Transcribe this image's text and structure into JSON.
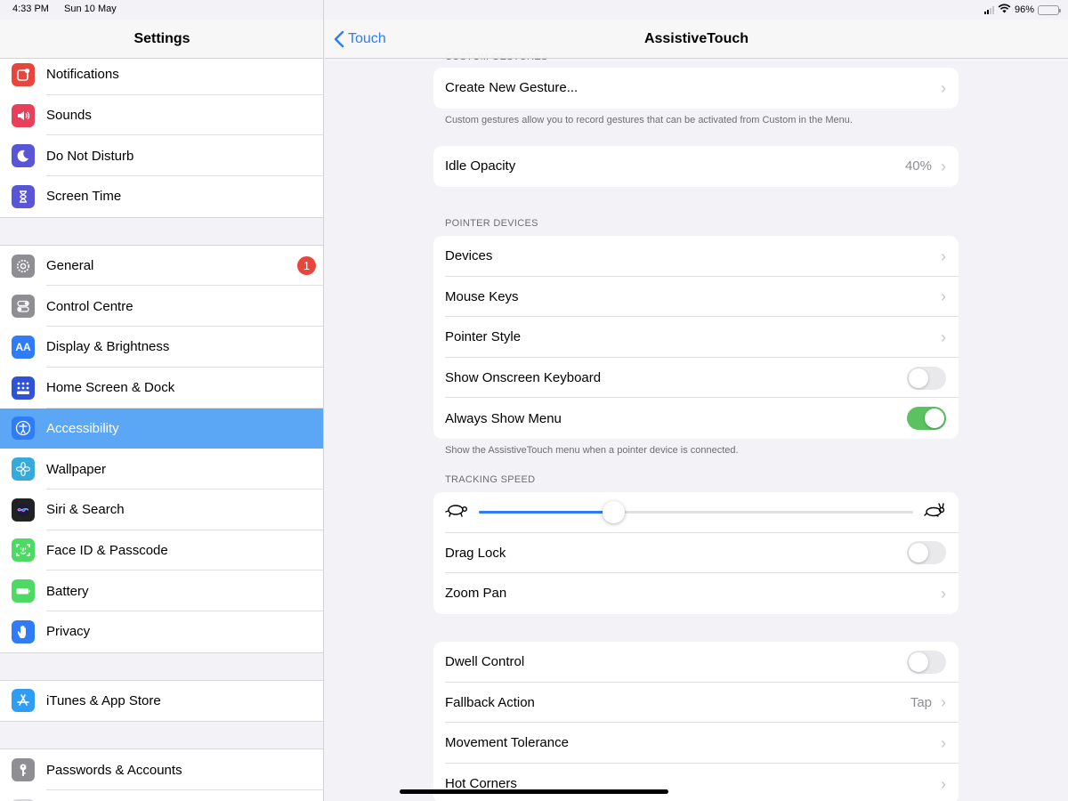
{
  "status_bar": {
    "time": "4:33 PM",
    "date": "Sun 10 May",
    "battery": "96%"
  },
  "sidebar": {
    "title": "Settings",
    "groups": [
      {
        "items": [
          {
            "label": "Notifications",
            "icon": "notifications-icon",
            "color": "#e8453c"
          },
          {
            "label": "Sounds",
            "icon": "sounds-icon",
            "color": "#e8405a"
          },
          {
            "label": "Do Not Disturb",
            "icon": "moon-icon",
            "color": "#5856d6"
          },
          {
            "label": "Screen Time",
            "icon": "hourglass-icon",
            "color": "#5856d6"
          }
        ]
      },
      {
        "items": [
          {
            "label": "General",
            "icon": "gear-icon",
            "color": "#8e8e93",
            "badge": "1"
          },
          {
            "label": "Control Centre",
            "icon": "toggles-icon",
            "color": "#8e8e93"
          },
          {
            "label": "Display & Brightness",
            "icon": "text-size-icon",
            "color": "#2f7cf6"
          },
          {
            "label": "Home Screen & Dock",
            "icon": "grid-icon",
            "color": "#2f52d6"
          },
          {
            "label": "Accessibility",
            "icon": "accessibility-icon",
            "color": "#2f7cf6",
            "selected": true
          },
          {
            "label": "Wallpaper",
            "icon": "flower-icon",
            "color": "#36aadc"
          },
          {
            "label": "Siri & Search",
            "icon": "siri-icon",
            "color": "#222222"
          },
          {
            "label": "Face ID & Passcode",
            "icon": "face-id-icon",
            "color": "#4cd964"
          },
          {
            "label": "Battery",
            "icon": "battery-icon",
            "color": "#4cd964"
          },
          {
            "label": "Privacy",
            "icon": "hand-icon",
            "color": "#2f7cf6"
          }
        ]
      },
      {
        "items": [
          {
            "label": "iTunes & App Store",
            "icon": "app-store-icon",
            "color": "#2f9cf6"
          }
        ]
      },
      {
        "items": [
          {
            "label": "Passwords & Accounts",
            "icon": "key-icon",
            "color": "#8e8e93"
          },
          {
            "label": "",
            "icon": "blank-icon",
            "color": "#d8d8dc"
          }
        ]
      }
    ]
  },
  "nav": {
    "back_label": "Touch",
    "title": "AssistiveTouch"
  },
  "main": {
    "clipped_header": "CUSTOM GESTURES",
    "create_gesture": "Create New Gesture...",
    "custom_footnote": "Custom gestures allow you to record gestures that can be activated from Custom in the Menu.",
    "idle_opacity_label": "Idle Opacity",
    "idle_opacity_value": "40%",
    "pointer_header": "POINTER DEVICES",
    "devices": "Devices",
    "mouse_keys": "Mouse Keys",
    "pointer_style": "Pointer Style",
    "show_keyboard": "Show Onscreen Keyboard",
    "show_keyboard_on": false,
    "always_show_menu": "Always Show Menu",
    "always_show_menu_on": true,
    "pointer_footnote": "Show the AssistiveTouch menu when a pointer device is connected.",
    "tracking_header": "TRACKING SPEED",
    "tracking_speed": 0.31,
    "drag_lock": "Drag Lock",
    "drag_lock_on": false,
    "zoom_pan": "Zoom Pan",
    "dwell_control": "Dwell Control",
    "dwell_control_on": false,
    "fallback_action": "Fallback Action",
    "fallback_value": "Tap",
    "movement_tolerance": "Movement Tolerance",
    "hot_corners": "Hot Corners"
  }
}
